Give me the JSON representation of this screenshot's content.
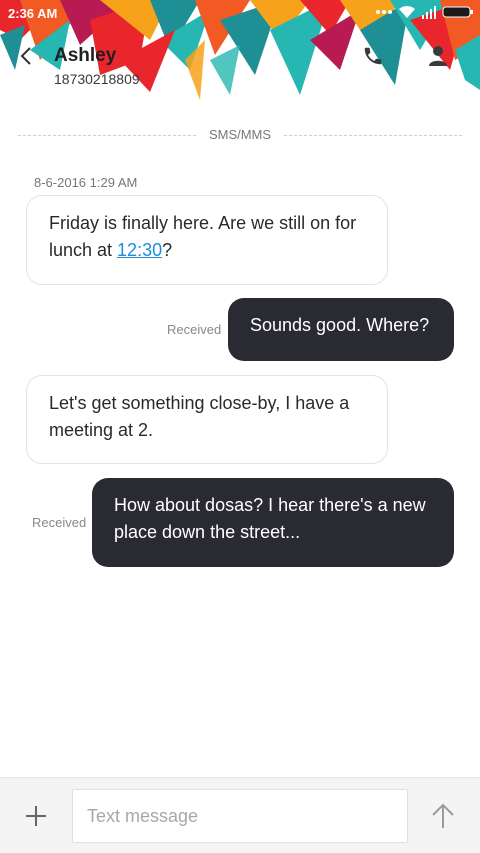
{
  "status_bar": {
    "time": "2:36 AM",
    "icons": [
      "more-dots-icon",
      "wifi-icon",
      "signal-icon",
      "battery-icon"
    ]
  },
  "header": {
    "contact_name": "Ashley",
    "contact_number": "18730218809",
    "icons": {
      "back": "back-arrow-icon",
      "call": "phone-icon",
      "profile": "person-icon"
    },
    "accent_colors": [
      "#e8262c",
      "#f25a24",
      "#f7a21b",
      "#27b7b2",
      "#1e8f95",
      "#b81a52"
    ]
  },
  "conversation": {
    "channel_label": "SMS/MMS",
    "date_label": "8-6-2016 1:29 AM",
    "messages": [
      {
        "direction": "incoming",
        "text_before_link": "Friday is finally here. Are we still on for lunch at ",
        "link_text": "12:30",
        "text_after_link": "?"
      },
      {
        "direction": "outgoing",
        "text": "Sounds good. Where?",
        "status": "Received"
      },
      {
        "direction": "incoming",
        "text": "Let's get something close-by, I have a meeting at 2."
      },
      {
        "direction": "outgoing",
        "text": "How about dosas? I hear there's a new place down the street...",
        "status": "Received"
      }
    ]
  },
  "composer": {
    "placeholder": "Text message",
    "value": "",
    "add_icon": "plus-icon",
    "send_icon": "send-arrow-icon"
  },
  "colors": {
    "outgoing_bubble": "#2a2a33",
    "link": "#1a8fe0"
  }
}
